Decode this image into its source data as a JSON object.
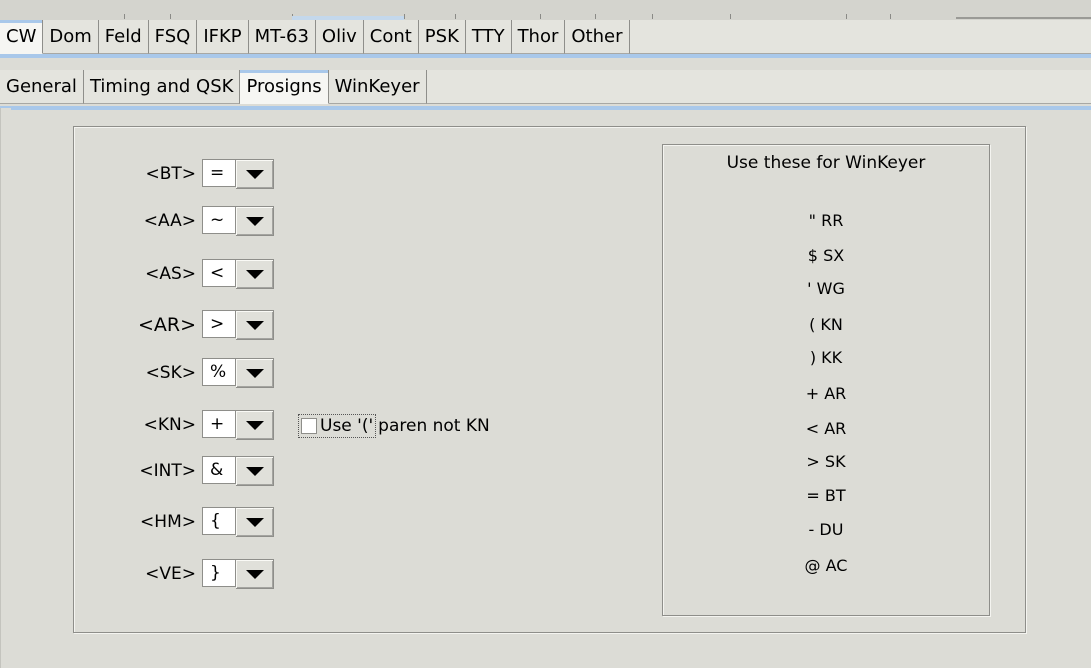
{
  "tabs_modes": [
    "CW",
    "Dom",
    "Feld",
    "FSQ",
    "IFKP",
    "MT-63",
    "Oliv",
    "Cont",
    "PSK",
    "TTY",
    "Thor",
    "Other"
  ],
  "tabs_cw": [
    "General",
    "Timing and QSK",
    "Prosigns",
    "WinKeyer"
  ],
  "prosigns": [
    {
      "label": "<BT>",
      "value": "="
    },
    {
      "label": "<AA>",
      "value": "~"
    },
    {
      "label": "<AS>",
      "value": "<"
    },
    {
      "label": "<AR>",
      "value": ">"
    },
    {
      "label": "<SK>",
      "value": "%"
    },
    {
      "label": "<KN>",
      "value": "+"
    },
    {
      "label": "<INT>",
      "value": "&"
    },
    {
      "label": "<HM>",
      "value": "{"
    },
    {
      "label": "<VE>",
      "value": "}"
    }
  ],
  "paren_checkbox": {
    "label_prefix": "Use '('",
    "label_suffix": "paren not KN",
    "checked": false
  },
  "winkeyer": {
    "title": "Use these for WinKeyer",
    "items": [
      "\" RR",
      "$ SX",
      "' WG",
      "( KN",
      ") KK",
      "+ AR",
      "< AR",
      "> SK",
      "= BT",
      "- DU",
      "@ AC"
    ]
  },
  "colors": {
    "accent": "#a9c8ea",
    "background": "#dcdcd6"
  },
  "icons": {
    "combo_button": "triangle-down-icon"
  }
}
